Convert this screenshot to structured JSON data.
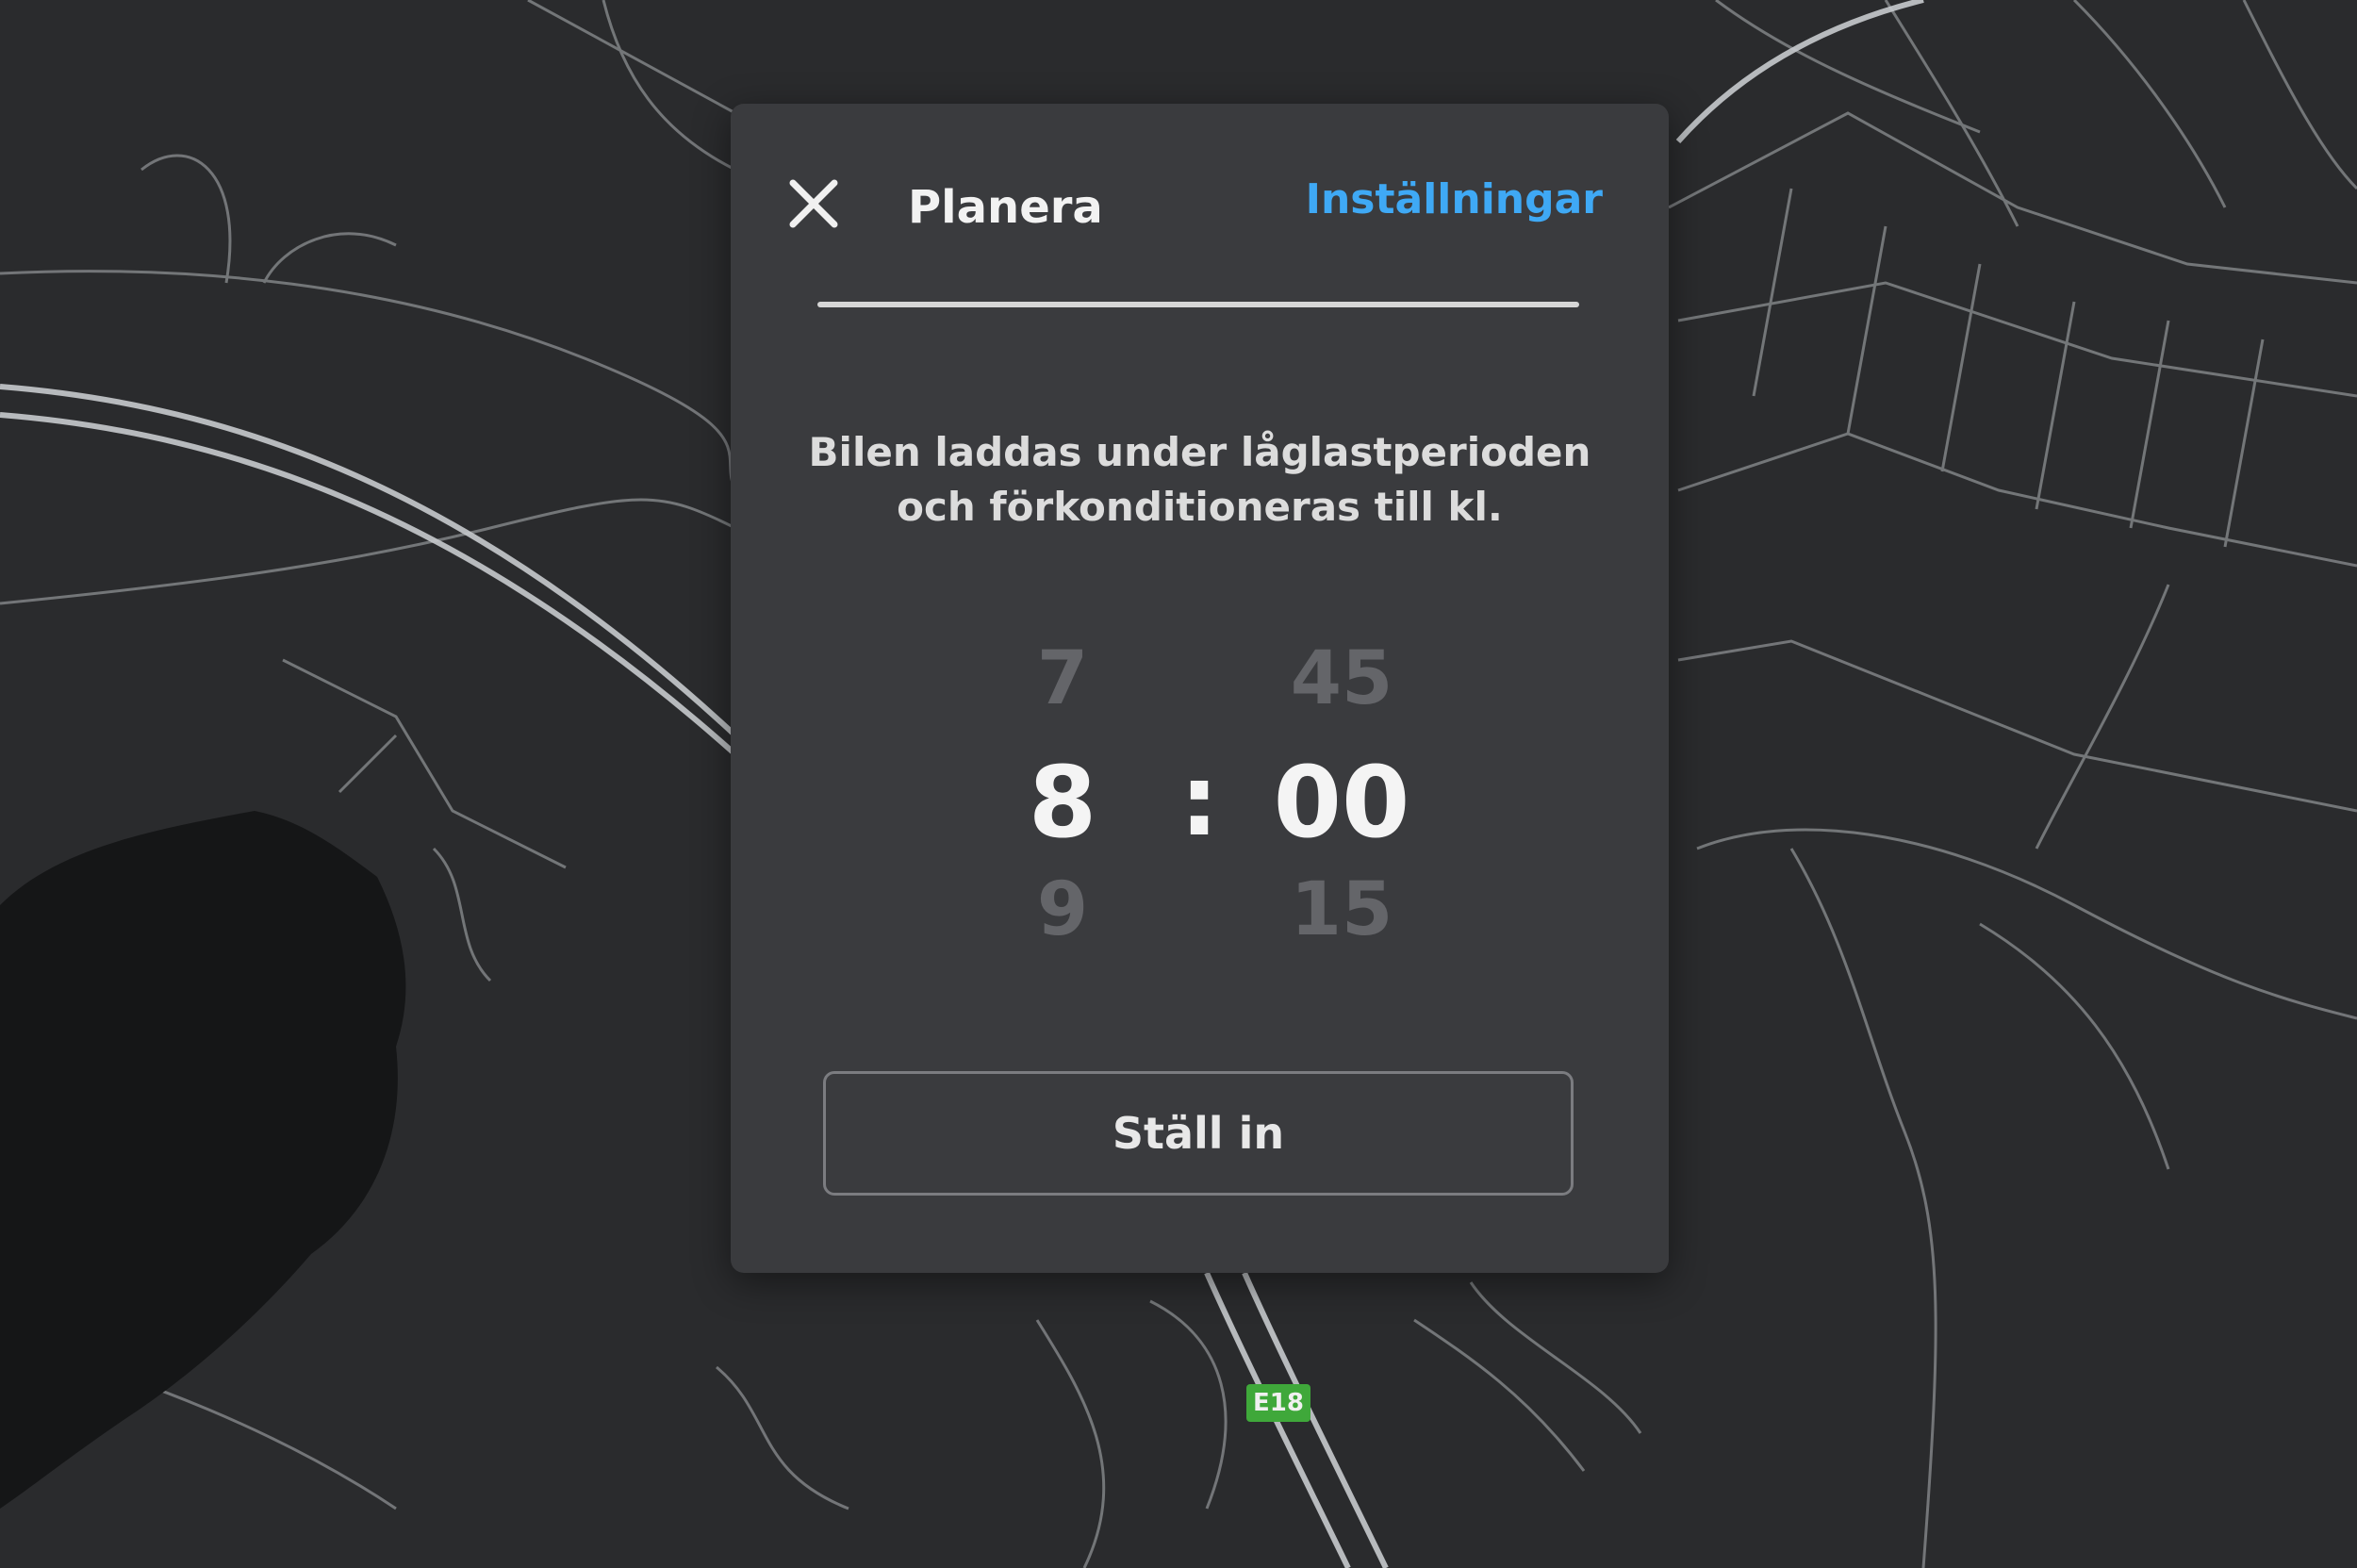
{
  "dialog": {
    "title": "Planera",
    "settings_label": "Inställningar",
    "description_line1": "Bilen laddas under låglastperioden",
    "description_line2": "och förkonditioneras till kl."
  },
  "time_picker": {
    "hour_prev": "7",
    "hour": "8",
    "hour_next": "9",
    "separator": ":",
    "minute_prev": "45",
    "minute": "00",
    "minute_next": "15"
  },
  "set_button_label": "Ställ in",
  "map": {
    "road_label": "E18"
  },
  "colors": {
    "accent": "#3fa9f5",
    "panel": "#3a3b3e",
    "map_background": "#2a2b2d",
    "road_shield": "#3fa83a"
  }
}
